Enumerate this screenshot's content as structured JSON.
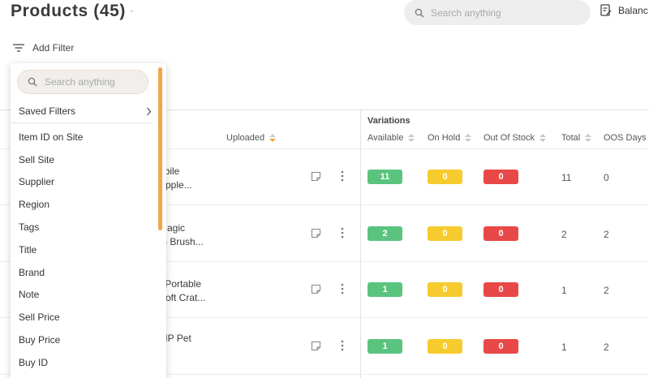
{
  "header": {
    "title": "Products (45)",
    "search_placeholder": "Search anything",
    "balance_label": "Balanc"
  },
  "toolbar": {
    "add_filter_label": "Add Filter"
  },
  "filter_dropdown": {
    "search_placeholder": "Search anything",
    "saved_filters_label": "Saved Filters",
    "items": [
      "Item ID on Site",
      "Sell Site",
      "Supplier",
      "Region",
      "Tags",
      "Title",
      "Brand",
      "Note",
      "Sell Price",
      "Buy Price",
      "Buy ID"
    ]
  },
  "table": {
    "variations_label": "Variations",
    "columns": {
      "uploaded": "Uploaded",
      "available": "Available",
      "on_hold": "On Hold",
      "out_of_stock": "Out Of Stock",
      "total": "Total",
      "oos_days": "OOS Days"
    },
    "rows": [
      {
        "name_line1": "obile",
        "name_line2": "Apple...",
        "available": "11",
        "on_hold": "0",
        "out_of_stock": "0",
        "total": "11",
        "oos_days": "0"
      },
      {
        "name_line1": "Magic",
        "name_line2": "m Brush...",
        "available": "2",
        "on_hold": "0",
        "out_of_stock": "0",
        "total": "2",
        "oos_days": "2"
      },
      {
        "name_line1": "r Portable",
        "name_line2": "Soft Crat...",
        "available": "1",
        "on_hold": "0",
        "out_of_stock": "0",
        "total": "1",
        "oos_days": "2"
      },
      {
        "name_line1": "ZIP Pet",
        "name_line2": "",
        "available": "1",
        "on_hold": "0",
        "out_of_stock": "0",
        "total": "1",
        "oos_days": "2"
      }
    ]
  },
  "colors": {
    "available": "#5ac47e",
    "on_hold": "#f6cb2e",
    "out_of_stock": "#e84848",
    "accent": "#f5a23a"
  }
}
